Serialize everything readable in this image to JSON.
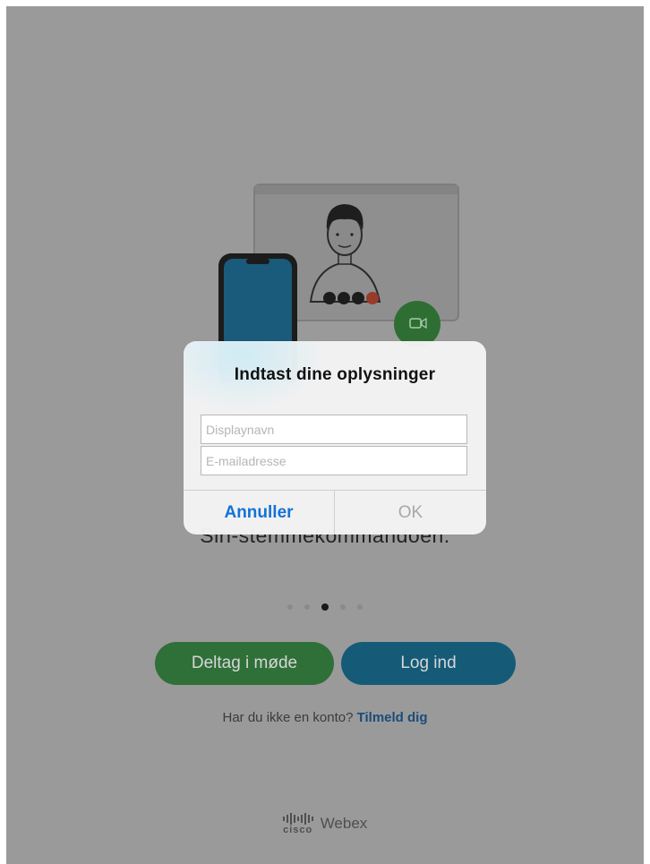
{
  "dialog": {
    "title": "Indtast dine oplysninger",
    "display_name_placeholder": "Displaynavn",
    "email_placeholder": "E-mailadresse",
    "cancel_label": "Annuller",
    "ok_label": "OK"
  },
  "background": {
    "subtitle_partial": "Siri-stemmekommandoen.",
    "carousel_pages": 5,
    "carousel_active_index": 2,
    "join_button": "Deltag i møde",
    "login_button": "Log ind",
    "signup_prompt": "Har du ikke en konto?",
    "signup_link": "Tilmeld dig",
    "brand_cisco": "cisco",
    "brand_webex": "Webex"
  },
  "colors": {
    "overlay_gray": "#9a9a9a",
    "join_green": "#2f6f38",
    "login_blue": "#155b77",
    "dialog_accent": "#1372d6"
  }
}
